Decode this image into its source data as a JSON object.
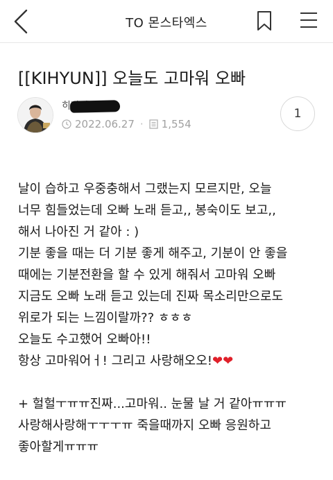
{
  "header": {
    "title": "TO 몬스타엑스"
  },
  "post": {
    "title": "[[KIHYUN]] 오늘도 고마워 오빠",
    "author": "히바라",
    "date": "2022.06.27",
    "views": "1,554",
    "comment_count": "1"
  },
  "content": {
    "lines": [
      "날이 습하고 우중충해서 그랬는지 모르지만, 오늘",
      "너무 힘들었는데 오빠 노래 듣고,, 봉숙이도 보고,,",
      "해서 나아진 거 같아 : )",
      "기분 좋을 때는 더 기분 좋게 해주고, 기분이 안 좋을",
      "때에는 기분전환을 할 수 있게 해줘서 고마워 오빠",
      "지금도 오빠 노래 듣고 있는데 진짜 목소리만으로도",
      "위로가 되는 느낌이랄까?? ㅎㅎㅎ",
      "오늘도 수고했어 오빠아!!",
      "항상 고마워어ㅓ! 그리고 사랑해오오!",
      "",
      "+ 헐헐ㅜㅠㅠ진짜...고마워.. 눈물 날 거 같아ㅠㅠㅠ",
      "사랑해사랑해ㅜㅜㅜㅠ 죽을때까지 오빠 응원하고",
      "좋아할게ㅠㅠㅠ"
    ],
    "hearts": "❤❤"
  },
  "colors": {
    "heart": "#e0202a",
    "meta": "#a0a0a0"
  },
  "icons": [
    "back-icon",
    "bookmark-icon",
    "menu-icon",
    "clock-icon",
    "document-icon"
  ]
}
